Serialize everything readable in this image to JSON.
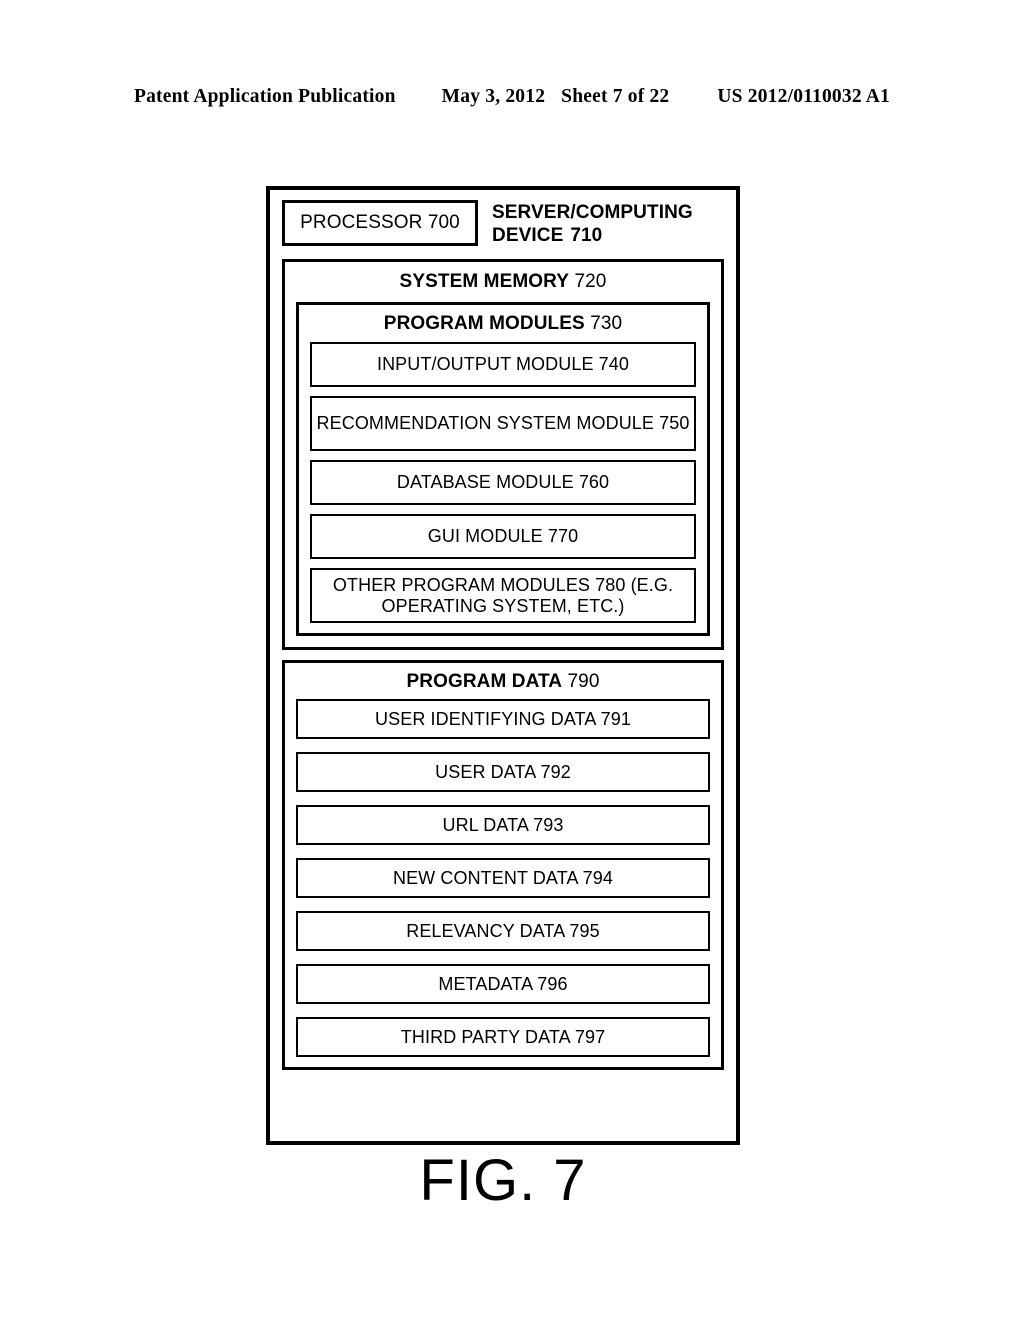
{
  "publication_header": {
    "title": "Patent Application Publication",
    "date": "May 3, 2012",
    "sheet": "Sheet 7 of 22",
    "number": "US 2012/0110032 A1"
  },
  "figure": {
    "caption": "FIG. 7",
    "device": {
      "processor_label": "PROCESSOR 700",
      "title_line1": "SERVER/COMPUTING",
      "title_line2": "DEVICE",
      "title_numeral": "710"
    },
    "system_memory": {
      "heading_label": "SYSTEM MEMORY",
      "heading_numeral": "720"
    },
    "program_modules": {
      "heading_label": "PROGRAM MODULES",
      "heading_numeral": "730",
      "items": [
        {
          "label": "INPUT/OUTPUT MODULE 740"
        },
        {
          "label": "RECOMMENDATION SYSTEM MODULE 750"
        },
        {
          "label": "DATABASE MODULE 760"
        },
        {
          "label": "GUI MODULE 770"
        },
        {
          "label": "OTHER PROGRAM MODULES 780 (E.G. OPERATING SYSTEM, ETC.)"
        }
      ]
    },
    "program_data": {
      "heading_label": "PROGRAM DATA",
      "heading_numeral": "790",
      "items": [
        {
          "label": "USER IDENTIFYING DATA 791"
        },
        {
          "label": "USER DATA 792"
        },
        {
          "label": "URL DATA 793"
        },
        {
          "label": "NEW CONTENT DATA 794"
        },
        {
          "label": "RELEVANCY DATA 795"
        },
        {
          "label": "METADATA 796"
        },
        {
          "label": "THIRD PARTY DATA 797"
        }
      ]
    }
  }
}
